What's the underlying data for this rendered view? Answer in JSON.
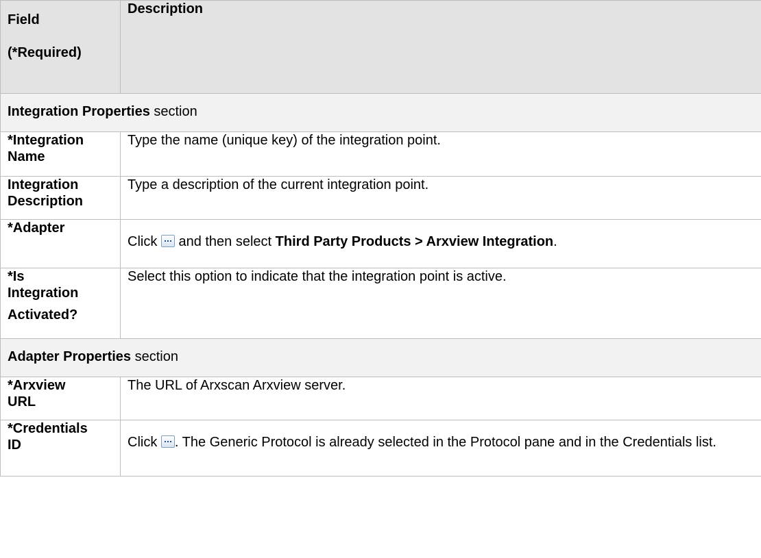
{
  "header": {
    "field_line1": "Field",
    "field_line2": "(*Required)",
    "description": "Description"
  },
  "sections": {
    "integration": {
      "title": "Integration Properties",
      "suffix": " section"
    },
    "adapter": {
      "title": "Adapter Properties",
      "suffix": " section"
    }
  },
  "rows": {
    "integration_name": {
      "field_line1": "*Integration",
      "field_line2": "Name",
      "description": "Type the name (unique key) of the integration point."
    },
    "integration_description": {
      "field_line1": "Integration",
      "field_line2": "Description",
      "description": "Type a description of the current integration point."
    },
    "adapter": {
      "field": "*Adapter",
      "desc_prefix": "Click ",
      "desc_middle": " and then select ",
      "desc_bold": "Third Party Products > Arxview Integration",
      "desc_suffix": "."
    },
    "is_activated": {
      "field_line1": "*Is",
      "field_line2": "Integration",
      "field_line3": "Activated?",
      "description": "Select this option to indicate that the integration point is active."
    },
    "arxview_url": {
      "field_line1": "*Arxview",
      "field_line2": "URL",
      "description": "The URL of Arxscan Arxview server."
    },
    "credentials_id": {
      "field_line1": "*Credentials",
      "field_line2": "ID",
      "desc_prefix": "Click ",
      "desc_suffix": ". The Generic Protocol is already selected in the Protocol pane and in the Credentials list."
    }
  },
  "icons": {
    "ellipsis_button": "ellipsis-icon"
  }
}
